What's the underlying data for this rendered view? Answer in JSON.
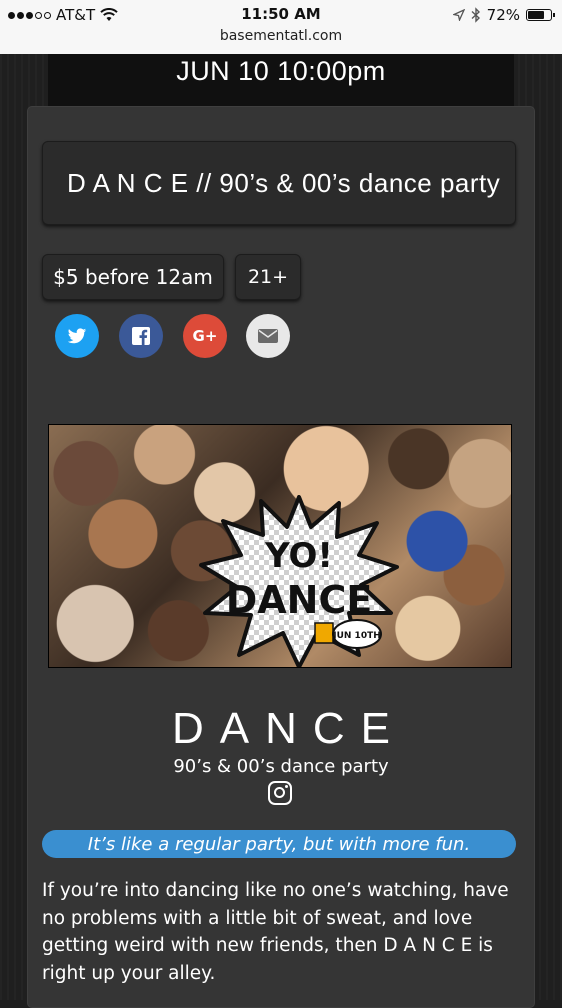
{
  "status_bar": {
    "carrier": "AT&T",
    "time": "11:50 AM",
    "url": "basementatl.com",
    "battery": "72%",
    "battery_level": 0.72,
    "signal_bars_filled": 3,
    "signal_bars_total": 5
  },
  "event": {
    "date": "JUN 10 10:00pm",
    "title_button": "D A N C E // 90’s & 00’s dance party",
    "price": "$5 before 12am",
    "age": "21+",
    "share_icons": [
      "twitter-icon",
      "facebook-icon",
      "google-plus-icon",
      "email-icon"
    ],
    "google_plus_label": "G+",
    "poster": {
      "text_line1": "YO!",
      "text_line2": "DANCE",
      "badge_text": "JUN 10TH"
    },
    "heading": "DANCE",
    "subheading": "90’s & 00’s dance party",
    "tagline": "It’s like a regular party, but with more fun.",
    "description": "If you’re into dancing like no one’s watching, have no problems with a little bit of sweat, and love getting weird with new friends, then D A N C E is right up your alley."
  },
  "colors": {
    "twitter": "#1da1f2",
    "facebook": "#3b5998",
    "google_plus": "#dd4b39",
    "email": "#e8e8e8",
    "tagline_bg": "#3a8fd0",
    "card_bg": "#353535"
  }
}
